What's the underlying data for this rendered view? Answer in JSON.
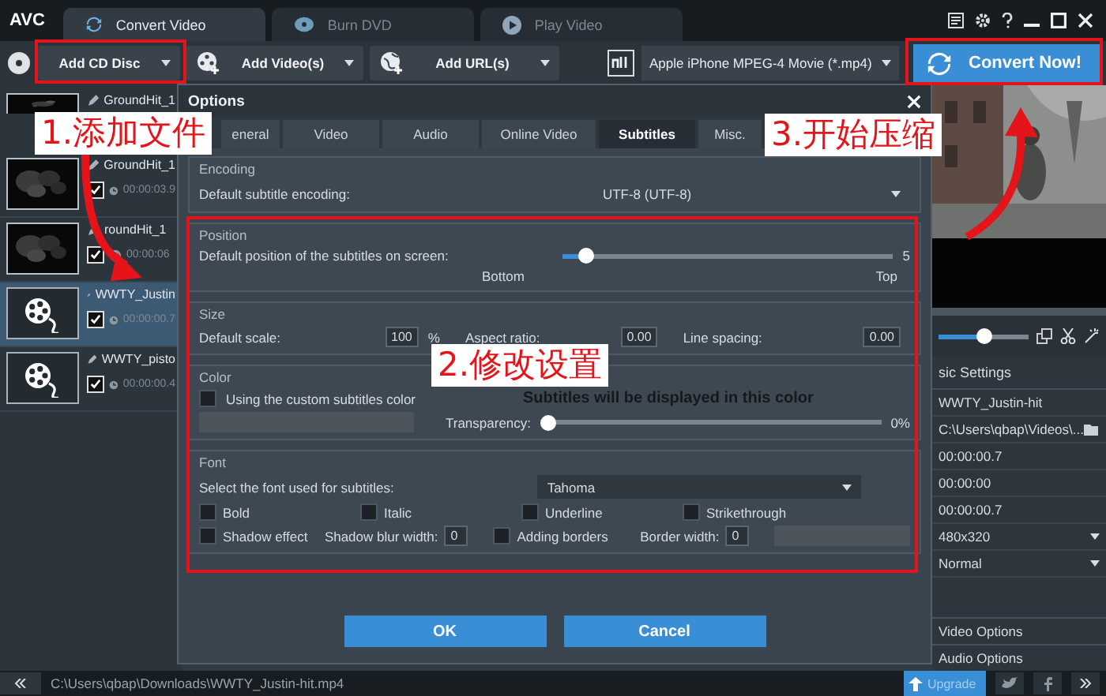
{
  "title_bar": {
    "logo": "AVC",
    "tabs": [
      {
        "label": "Convert Video",
        "selected": true
      },
      {
        "label": "Burn DVD",
        "selected": false
      },
      {
        "label": "Play Video",
        "selected": false
      }
    ]
  },
  "toolbar": {
    "buttons": [
      {
        "label": "Add CD Disc"
      },
      {
        "label": "Add Video(s)"
      },
      {
        "label": "Add URL(s)"
      }
    ],
    "profile": "Apple iPhone MPEG-4 Movie (*.mp4)",
    "convert_button": "Convert Now!"
  },
  "files": [
    {
      "name": "GroundHit_1",
      "selected": false,
      "kind": "video"
    },
    {
      "name": "GroundHit_1",
      "duration": "00:00:03.9",
      "checked": true,
      "selected": false,
      "kind": "video"
    },
    {
      "name": "roundHit_1",
      "duration": "00:00:06",
      "checked": true,
      "selected": false,
      "kind": "video"
    },
    {
      "name": "WWTY_Justin",
      "duration": "00:00:00.7",
      "checked": true,
      "selected": true,
      "kind": "reel"
    },
    {
      "name": "WWTY_pisto",
      "duration": "00:00:00.4",
      "checked": true,
      "selected": false,
      "kind": "reel"
    }
  ],
  "preview": {
    "kind": "picture",
    "level": 0.5
  },
  "settings": {
    "title": "sic Settings",
    "rows": [
      {
        "kind": "text",
        "value": "WWTY_Justin-hit"
      },
      {
        "kind": "folder",
        "value": "C:\\Users\\qbap\\Videos\\..."
      },
      {
        "kind": "text",
        "value": "00:00:00.7"
      },
      {
        "kind": "text",
        "value": "00:00:00"
      },
      {
        "kind": "text",
        "value": "00:00:00.7"
      },
      {
        "kind": "dropdown",
        "value": "480x320"
      },
      {
        "kind": "dropdown",
        "value": "Normal"
      }
    ],
    "sections": [
      "Video Options",
      "Audio Options"
    ]
  },
  "status_bar": {
    "path": "C:\\Users\\qbap\\Downloads\\WWTY_Justin-hit.mp4",
    "upgrade_button": "Upgrade"
  },
  "dialog": {
    "title": "Options",
    "tabs": [
      {
        "label": "eneral",
        "selected": false
      },
      {
        "label": "Video",
        "selected": false
      },
      {
        "label": "Audio",
        "selected": false
      },
      {
        "label": "Online Video",
        "selected": false
      },
      {
        "label": "Subtitles",
        "selected": true
      },
      {
        "label": "Misc.",
        "selected": false
      }
    ],
    "encoding": {
      "title": "Encoding",
      "label": "Default subtitle encoding:",
      "value": "UTF-8 (UTF-8)"
    },
    "position": {
      "title": "Position",
      "label": "Default position of the subtitles on screen:",
      "level": 0.05,
      "reading": "5",
      "min_label": "Bottom",
      "max_label": "Top"
    },
    "size": {
      "title": "Size",
      "fields": [
        {
          "label": "Default scale:",
          "value": "100",
          "unit": "%"
        },
        {
          "label": "Aspect ratio:",
          "value": "0.00"
        },
        {
          "label": "Line spacing:",
          "value": "0.00"
        }
      ]
    },
    "color": {
      "title": "Color",
      "checkbox": {
        "label": "Using the custom subtitles color",
        "checked": false
      },
      "sample": "Subtitles will be displayed in this color",
      "transparency": {
        "label": "Transparency:",
        "level": 0,
        "reading": "0%"
      }
    },
    "font": {
      "title": "Font",
      "label": "Select the font used for subtitles:",
      "value": "Tahoma",
      "styles": [
        {
          "label": "Bold",
          "checked": false
        },
        {
          "label": "Italic",
          "checked": false
        },
        {
          "label": "Underline",
          "checked": false
        },
        {
          "label": "Strikethrough",
          "checked": false
        }
      ],
      "shadow": {
        "label": "Shadow effect",
        "checked": false
      },
      "blur": {
        "label": "Shadow blur width:",
        "value": "0"
      },
      "borders": {
        "label": "Adding borders",
        "checked": false
      },
      "border_width": {
        "label": "Border width:",
        "value": "0"
      }
    },
    "buttons": [
      "OK",
      "Cancel"
    ]
  },
  "annotations": [
    {
      "text": "1.添加文件"
    },
    {
      "text": "2.修改设置"
    },
    {
      "text": "3.开始压缩"
    }
  ]
}
